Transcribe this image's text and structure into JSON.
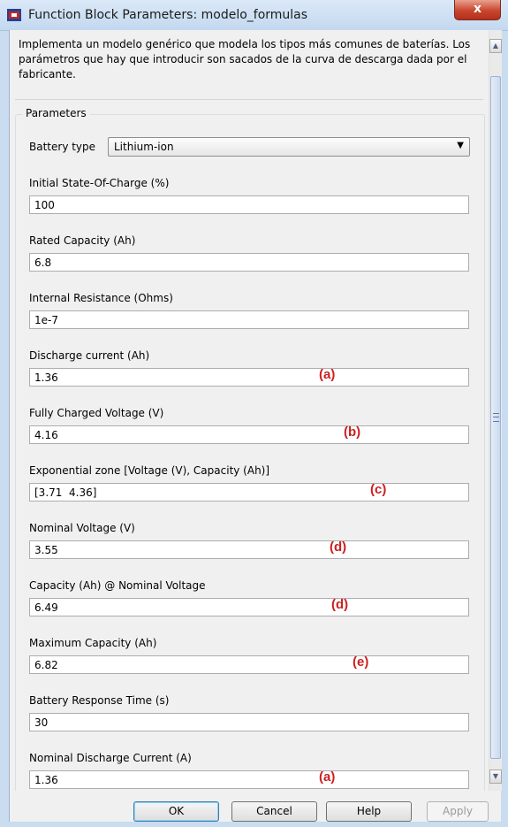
{
  "window": {
    "title": "Function Block Parameters: modelo_formulas",
    "close_glyph": "x"
  },
  "description": "Implementa un modelo genérico que modela los tipos más comunes de baterías. Los parámetros que hay que introducir son sacados de la curva de descarga dada por el fabricante.",
  "parameters_group": "Parameters",
  "battery_type": {
    "label": "Battery type",
    "value": "Lithium-ion"
  },
  "fields": [
    {
      "label": "Initial State-Of-Charge (%)",
      "value": "100",
      "annotation": ""
    },
    {
      "label": "Rated Capacity (Ah)",
      "value": "6.8",
      "annotation": ""
    },
    {
      "label": "Internal Resistance (Ohms)",
      "value": "1e-7",
      "annotation": ""
    },
    {
      "label": "Discharge current (Ah)",
      "value": "1.36",
      "annotation": "(a)"
    },
    {
      "label": "Fully Charged Voltage (V)",
      "value": "4.16",
      "annotation": "(b)"
    },
    {
      "label": "Exponential zone [Voltage (V), Capacity (Ah)]",
      "value": "[3.71  4.36]",
      "annotation": "(c)"
    },
    {
      "label": "Nominal Voltage (V)",
      "value": "3.55",
      "annotation": "(d)"
    },
    {
      "label": "Capacity (Ah) @ Nominal Voltage",
      "value": "6.49",
      "annotation": "(d)"
    },
    {
      "label": "Maximum Capacity (Ah)",
      "value": "6.82",
      "annotation": "(e)"
    },
    {
      "label": "Battery Response Time (s)",
      "value": "30",
      "annotation": ""
    },
    {
      "label": "Nominal Discharge Current (A)",
      "value": "1.36",
      "annotation": "(a)"
    }
  ],
  "buttons": {
    "ok": "OK",
    "cancel": "Cancel",
    "help": "Help",
    "apply": "Apply"
  },
  "colors": {
    "annotation": "#cc1f1f",
    "close_button": "#c9452e",
    "scroll_thumb": "#c8d8ee"
  }
}
